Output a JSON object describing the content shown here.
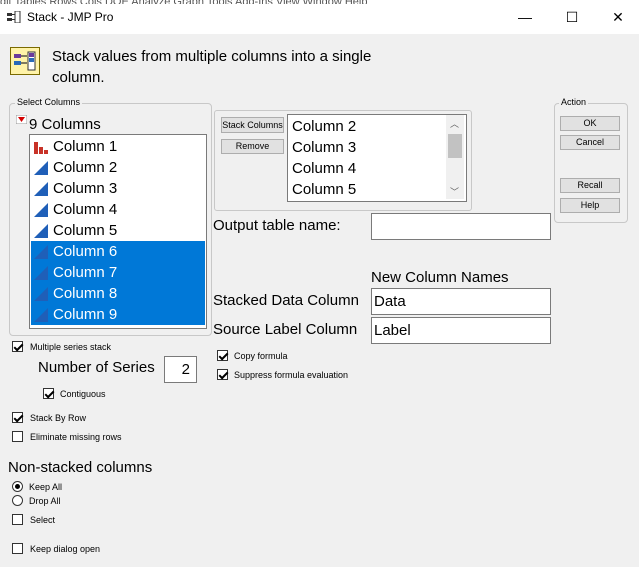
{
  "window": {
    "title": "Stack - JMP Pro",
    "menu_fragment": "dit   Tables   Rows   Cols   DOE   Analyze   Graph   Tools   Add-Ins   View   Window   Help",
    "minimize": "—",
    "maximize": "☐",
    "close": "✕"
  },
  "header": {
    "description_line1": "Stack values from multiple columns into a single",
    "description_line2": "column."
  },
  "select_columns": {
    "legend": "Select Columns",
    "count_label": "9 Columns",
    "items": [
      {
        "label": "Column 1",
        "icon": "bar-chart-icon",
        "selected": false
      },
      {
        "label": "Column 2",
        "icon": "continuous-icon",
        "selected": false
      },
      {
        "label": "Column 3",
        "icon": "continuous-icon",
        "selected": false
      },
      {
        "label": "Column 4",
        "icon": "continuous-icon",
        "selected": false
      },
      {
        "label": "Column 5",
        "icon": "continuous-icon",
        "selected": false
      },
      {
        "label": "Column 6",
        "icon": "continuous-icon",
        "selected": true
      },
      {
        "label": "Column 7",
        "icon": "continuous-icon",
        "selected": true
      },
      {
        "label": "Column 8",
        "icon": "continuous-icon",
        "selected": true
      },
      {
        "label": "Column 9",
        "icon": "continuous-icon",
        "selected": true
      }
    ]
  },
  "stack_columns": {
    "button": "Stack Columns",
    "remove": "Remove",
    "items": [
      "Column 2",
      "Column 3",
      "Column 4",
      "Column 5"
    ]
  },
  "action": {
    "legend": "Action",
    "ok": "OK",
    "cancel": "Cancel",
    "recall": "Recall",
    "help": "Help"
  },
  "output": {
    "table_name_label": "Output table name:",
    "table_name_value": "",
    "new_names_heading": "New Column Names",
    "stacked_label": "Stacked Data Column",
    "stacked_value": "Data",
    "source_label": "Source Label Column",
    "source_value": "Label"
  },
  "options": {
    "multiple_series": {
      "label": "Multiple series stack",
      "checked": true
    },
    "number_of_series_label": "Number of Series",
    "number_of_series_value": "2",
    "contiguous": {
      "label": "Contiguous",
      "checked": true
    },
    "copy_formula": {
      "label": "Copy formula",
      "checked": true
    },
    "suppress_eval": {
      "label": "Suppress formula evaluation",
      "checked": true
    },
    "stack_by_row": {
      "label": "Stack By Row",
      "checked": true
    },
    "eliminate_missing": {
      "label": "Eliminate missing rows",
      "checked": false
    }
  },
  "non_stacked": {
    "heading": "Non-stacked columns",
    "keep_all": {
      "label": "Keep All",
      "selected": true
    },
    "drop_all": {
      "label": "Drop All",
      "selected": false
    },
    "select": {
      "label": "Select",
      "checked": false
    }
  },
  "keep_dialog_open": {
    "label": "Keep dialog open",
    "checked": false
  }
}
